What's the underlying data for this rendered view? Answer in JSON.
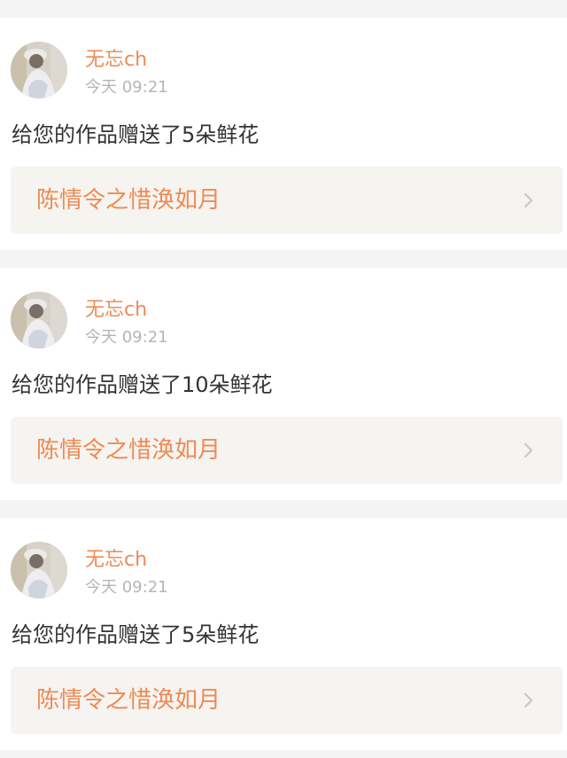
{
  "feed": {
    "items": [
      {
        "username": "无忘ch",
        "time": "今天 09:21",
        "message": "给您的作品赠送了5朵鲜花",
        "work_title": "陈情令之惜涣如月"
      },
      {
        "username": "无忘ch",
        "time": "今天 09:21",
        "message": "给您的作品赠送了10朵鲜花",
        "work_title": "陈情令之惜涣如月"
      },
      {
        "username": "无忘ch",
        "time": "今天 09:21",
        "message": "给您的作品赠送了5朵鲜花",
        "work_title": "陈情令之惜涣如月"
      }
    ]
  },
  "colors": {
    "accent": "#ef8a55",
    "text": "#333333",
    "muted": "#b5b5b5",
    "card_link_bg": "#f5f4f0",
    "page_bg": "#f4f4f4"
  },
  "icons": {
    "avatar": "user-avatar-image",
    "chevron": "chevron-right-icon"
  }
}
